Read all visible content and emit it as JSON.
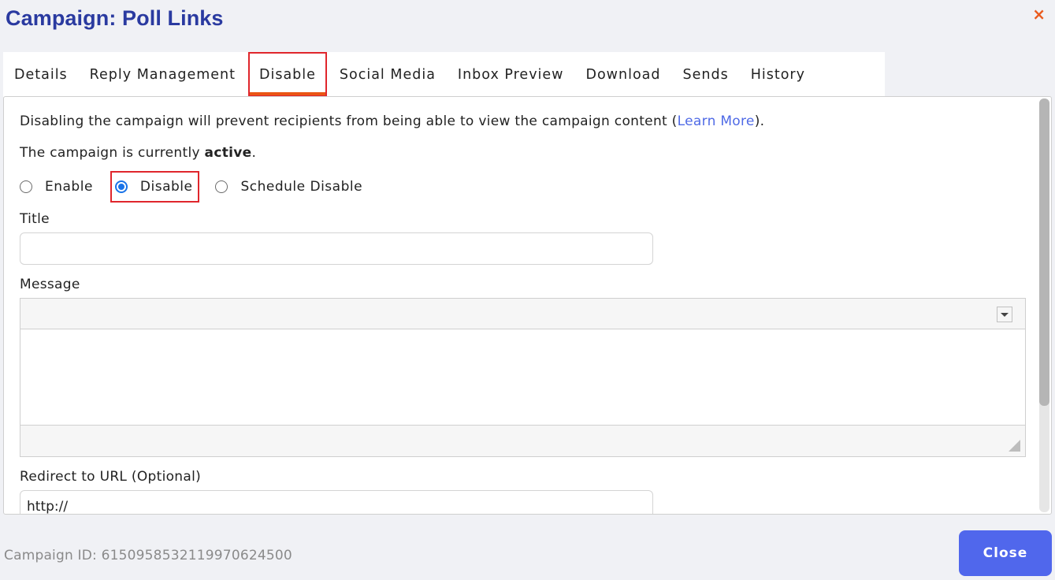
{
  "header": {
    "title": "Campaign: Poll Links",
    "close_icon": "×"
  },
  "tabs": [
    {
      "label": "Details",
      "active": false
    },
    {
      "label": "Reply Management",
      "active": false
    },
    {
      "label": "Disable",
      "active": true
    },
    {
      "label": "Social Media",
      "active": false
    },
    {
      "label": "Inbox Preview",
      "active": false
    },
    {
      "label": "Download",
      "active": false
    },
    {
      "label": "Sends",
      "active": false
    },
    {
      "label": "History",
      "active": false
    }
  ],
  "disable_panel": {
    "description_prefix": "Disabling the campaign will prevent recipients from being able to view the campaign content (",
    "learn_more": "Learn More",
    "description_suffix": ").",
    "status_prefix": "The campaign is currently ",
    "status_value": "active",
    "status_suffix": ".",
    "options": [
      {
        "label": "Enable",
        "checked": false
      },
      {
        "label": "Disable",
        "checked": true
      },
      {
        "label": "Schedule Disable",
        "checked": false
      }
    ],
    "title_label": "Title",
    "title_value": "",
    "message_label": "Message",
    "message_value": "",
    "redirect_label": "Redirect to URL (Optional)",
    "redirect_value": "http://"
  },
  "footer": {
    "campaign_id": "Campaign ID: 6150958532119970624500",
    "close_label": "Close"
  },
  "colors": {
    "title": "#2a3aa0",
    "accent": "#5067ec",
    "highlight": "#e0262c",
    "active_tab_underline": "#ea5514",
    "link": "#4f6ae6"
  }
}
